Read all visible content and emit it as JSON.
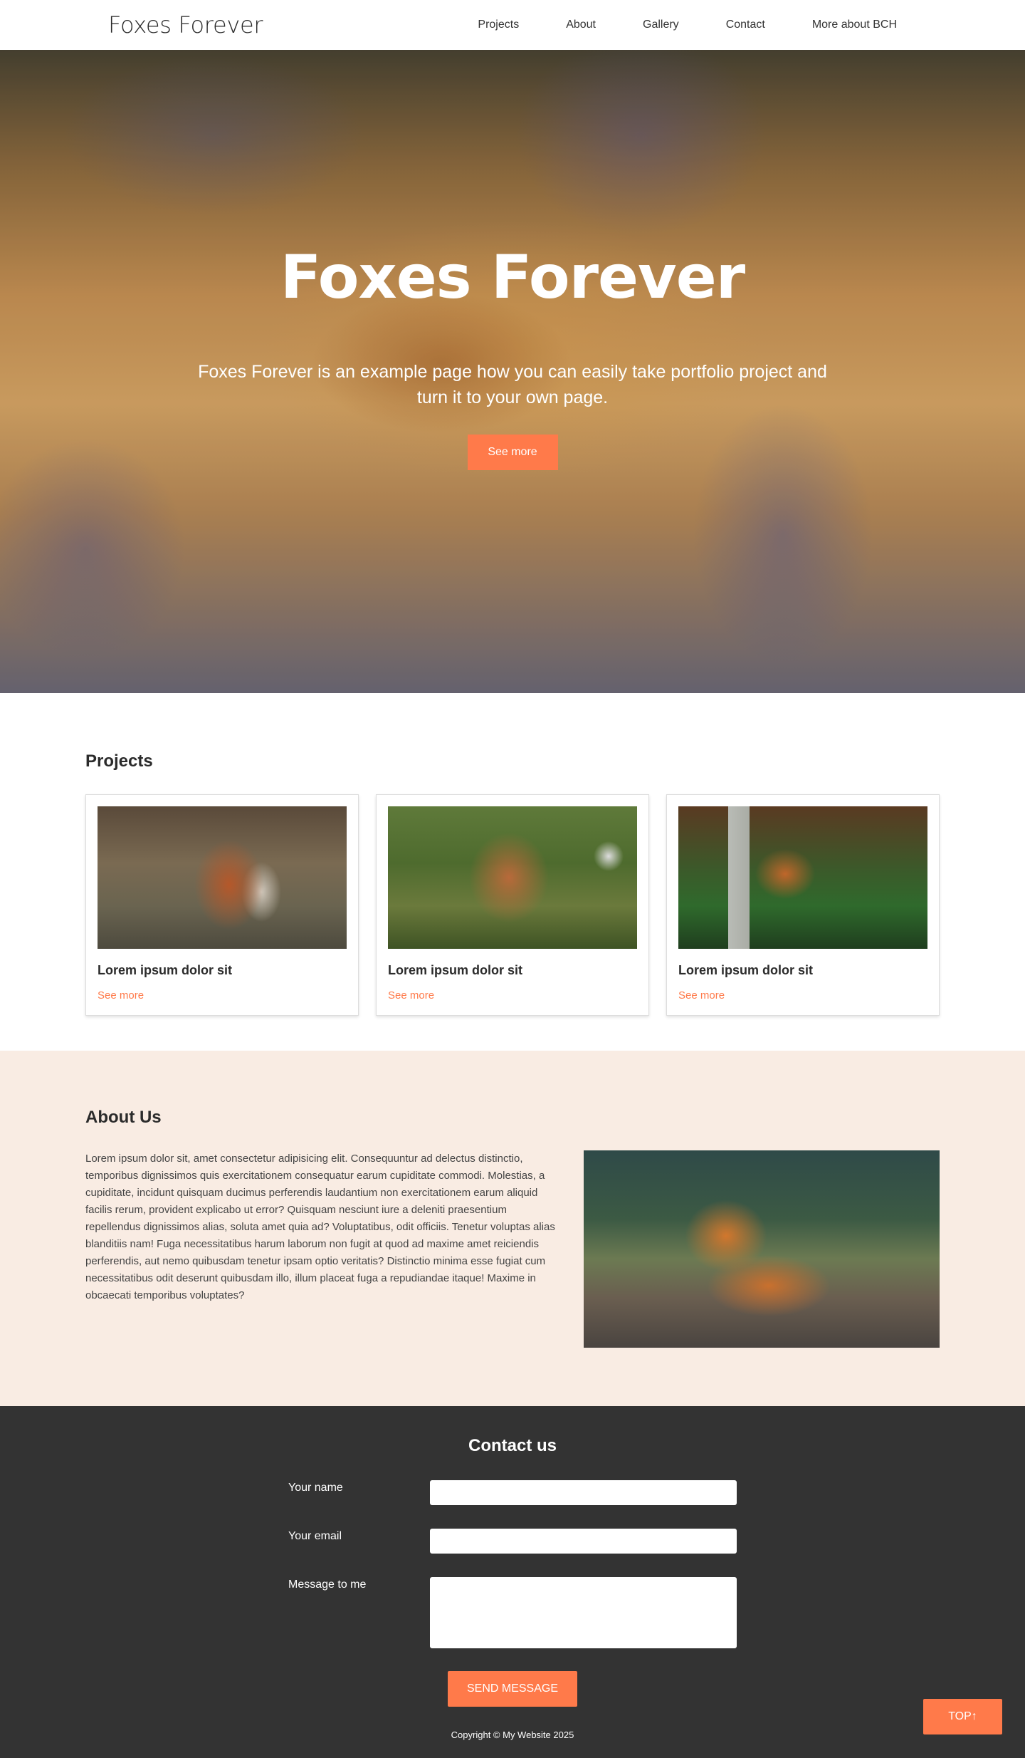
{
  "nav": {
    "brand": "Foxes Forever",
    "links": [
      "Projects",
      "About",
      "Gallery",
      "Contact",
      "More about BCH"
    ]
  },
  "hero": {
    "title": "Foxes Forever",
    "subtitle": "Foxes Forever is an example page how you can easily take portfolio project and turn it to your own page.",
    "button": "See more"
  },
  "projects": {
    "title": "Projects",
    "cards": [
      {
        "title": "Lorem ipsum dolor sit",
        "link": "See more"
      },
      {
        "title": "Lorem ipsum dolor sit",
        "link": "See more"
      },
      {
        "title": "Lorem ipsum dolor sit",
        "link": "See more"
      }
    ]
  },
  "about": {
    "title": "About Us",
    "text": "Lorem ipsum dolor sit, amet consectetur adipisicing elit. Consequuntur ad delectus distinctio, temporibus dignissimos quis exercitationem consequatur earum cupiditate commodi. Molestias, a cupiditate, incidunt quisquam ducimus perferendis laudantium non exercitationem earum aliquid facilis rerum, provident explicabo ut error? Quisquam nesciunt iure a deleniti praesentium repellendus dignissimos alias, soluta amet quia ad? Voluptatibus, odit officiis. Tenetur voluptas alias blanditiis nam! Fuga necessitatibus harum laborum non fugit at quod ad maxime amet reiciendis perferendis, aut nemo quibusdam tenetur ipsam optio veritatis? Distinctio minima esse fugiat cum necessitatibus odit deserunt quibusdam illo, illum placeat fuga a repudiandae itaque! Maxime in obcaecati temporibus voluptates?"
  },
  "contact": {
    "title": "Contact us",
    "name_label": "Your name",
    "email_label": "Your email",
    "message_label": "Message to me",
    "send_button": "SEND MESSAGE",
    "copyright": "Copyright © My Website 2025",
    "top_button": "TOP↑"
  },
  "colors": {
    "accent": "#ff7a4a",
    "about_bg": "#f9ece3",
    "footer_bg": "#333333"
  }
}
